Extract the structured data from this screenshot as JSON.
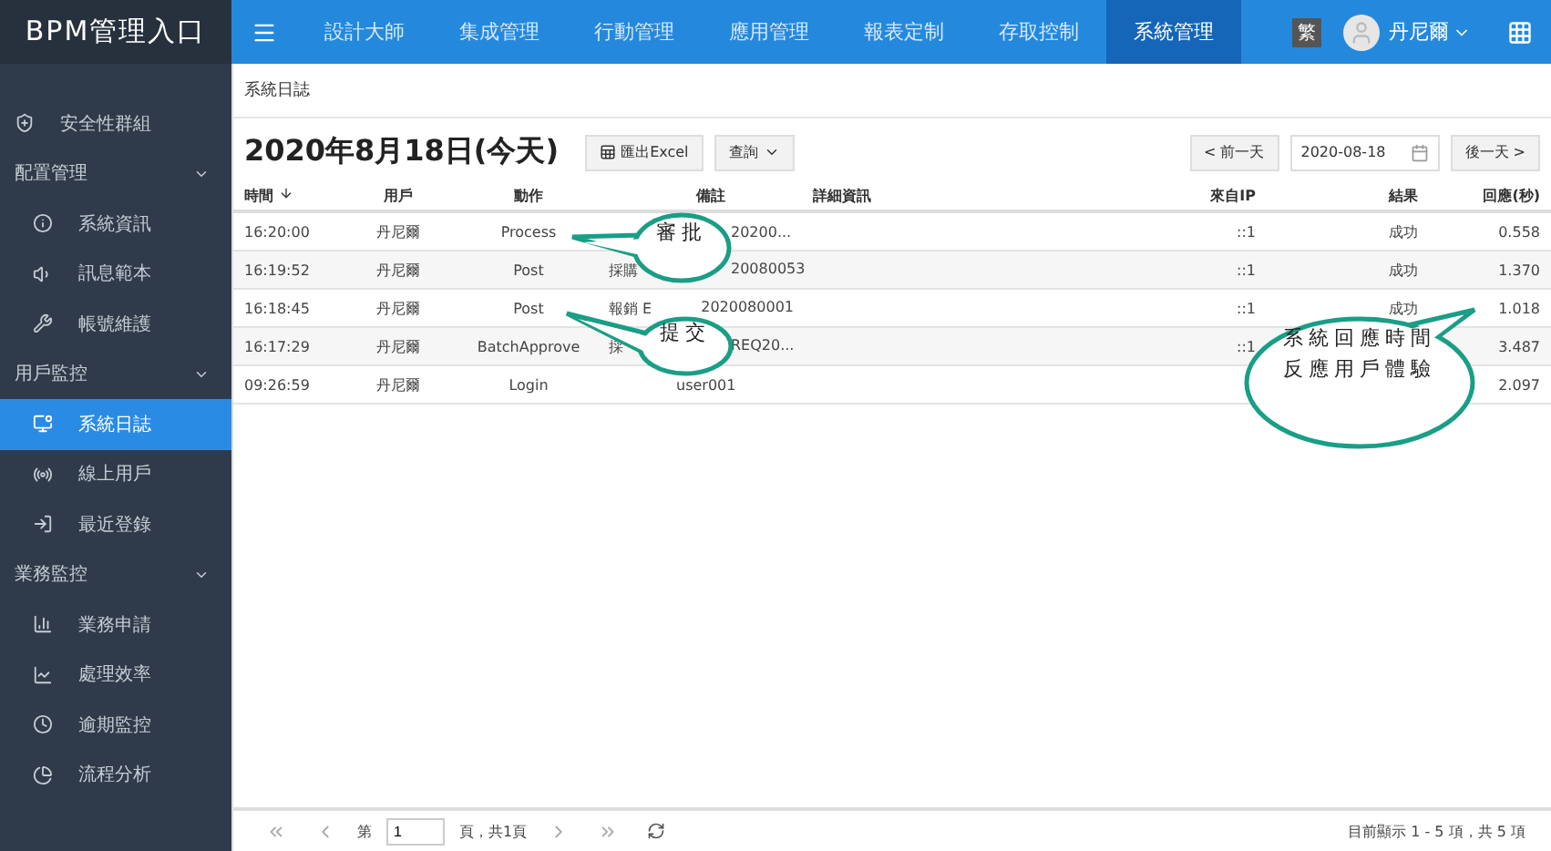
{
  "logo": "BPM管理入口",
  "nav": [
    {
      "label": "設計大師",
      "selected": false
    },
    {
      "label": "集成管理",
      "selected": false
    },
    {
      "label": "行動管理",
      "selected": false
    },
    {
      "label": "應用管理",
      "selected": false
    },
    {
      "label": "報表定制",
      "selected": false
    },
    {
      "label": "存取控制",
      "selected": false
    },
    {
      "label": "系統管理",
      "selected": true
    }
  ],
  "lang_badge": "繁",
  "user": "丹尼爾",
  "sidebar": [
    {
      "kind": "item",
      "label": "安全性群組",
      "selected": false
    },
    {
      "kind": "group",
      "label": "配置管理",
      "expanded": true,
      "children": [
        {
          "label": "系統資訊",
          "selected": false
        },
        {
          "label": "訊息範本",
          "selected": false
        },
        {
          "label": "帳號維護",
          "selected": false
        }
      ]
    },
    {
      "kind": "group",
      "label": "用戶監控",
      "expanded": true,
      "children": [
        {
          "label": "系統日誌",
          "selected": true
        },
        {
          "label": "線上用戶",
          "selected": false
        },
        {
          "label": "最近登錄",
          "selected": false
        }
      ]
    },
    {
      "kind": "group",
      "label": "業務監控",
      "expanded": true,
      "children": [
        {
          "label": "業務申請",
          "selected": false
        },
        {
          "label": "處理效率",
          "selected": false
        },
        {
          "label": "逾期監控",
          "selected": false
        },
        {
          "label": "流程分析",
          "selected": false
        }
      ]
    }
  ],
  "breadcrumb": "系統日誌",
  "title": "2020年8月18日(今天)",
  "export_button": "匯出Excel",
  "query_button": "查詢",
  "prev_day": "< 前一天",
  "date": "2020-08-18",
  "next_day": "後一天 >",
  "columns": [
    "時間",
    "用戶",
    "動作",
    "備註",
    "詳細資訊",
    "來自IP",
    "結果",
    "回應(秒)"
  ],
  "rows": [
    {
      "time": "16:20:00",
      "user": "丹尼爾",
      "action": "Process",
      "remark": [
        "20200..."
      ],
      "ip": "::1",
      "result": "成功",
      "response": "0.558"
    },
    {
      "time": "16:19:52",
      "user": "丹尼爾",
      "action": "Post",
      "remark": [
        "採購",
        "20080053"
      ],
      "ip": "::1",
      "result": "成功",
      "response": "1.370"
    },
    {
      "time": "16:18:45",
      "user": "丹尼爾",
      "action": "Post",
      "remark": [
        "報銷 E",
        "2020080001"
      ],
      "ip": "::1",
      "result": "成功",
      "response": "1.018"
    },
    {
      "time": "16:17:29",
      "user": "丹尼爾",
      "action": "BatchApprove",
      "remark": [
        "採",
        "REQ20..."
      ],
      "ip": "::1",
      "response": "3.487"
    },
    {
      "time": "09:26:59",
      "user": "丹尼爾",
      "action": "Login",
      "remark": [
        "user001"
      ],
      "response": "2.097"
    }
  ],
  "pager": {
    "page_label": "第",
    "page": "1",
    "of_label": "頁，共1頁",
    "summary": "目前顯示 1 - 5 項，共 5 項"
  },
  "callouts": [
    {
      "lines": [
        "審批"
      ]
    },
    {
      "lines": [
        "提交"
      ]
    },
    {
      "lines": [
        "系統回應時間",
        "反應用戶體驗"
      ]
    }
  ]
}
